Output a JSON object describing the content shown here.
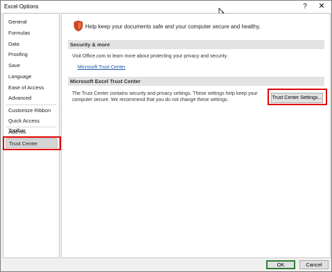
{
  "window": {
    "title": "Excel Options",
    "help_label": "?",
    "close_label": "✕"
  },
  "sidebar": {
    "items": [
      {
        "label": "General"
      },
      {
        "label": "Formulas"
      },
      {
        "label": "Data"
      },
      {
        "label": "Proofing"
      },
      {
        "label": "Save"
      },
      {
        "label": "Language"
      },
      {
        "label": "Ease of Access"
      },
      {
        "label": "Advanced"
      },
      {
        "label": "Customize Ribbon"
      },
      {
        "label": "Quick Access Toolbar"
      },
      {
        "label": "Add-ins"
      },
      {
        "label": "Trust Center"
      }
    ],
    "selected": "Trust Center"
  },
  "main": {
    "header": "Help keep your documents safe and your computer secure and healthy.",
    "security_section": {
      "title": "Security & more",
      "text": "Visit Office.com to learn more about protecting your privacy and security.",
      "link": "Microsoft Trust Center"
    },
    "trust_section": {
      "title": "Microsoft Excel Trust Center",
      "text_line1": "The Trust Center contains security and privacy settings. These settings help keep your",
      "text_line2": "computer secure. We recommend that you do not change these settings.",
      "button": "Trust Center Settings..."
    }
  },
  "footer": {
    "ok": "OK",
    "cancel": "Cancel"
  },
  "colors": {
    "highlight": "#e00000",
    "link": "#1a56a8",
    "ok_border": "#2e7d32",
    "shield": "#d2461e"
  }
}
